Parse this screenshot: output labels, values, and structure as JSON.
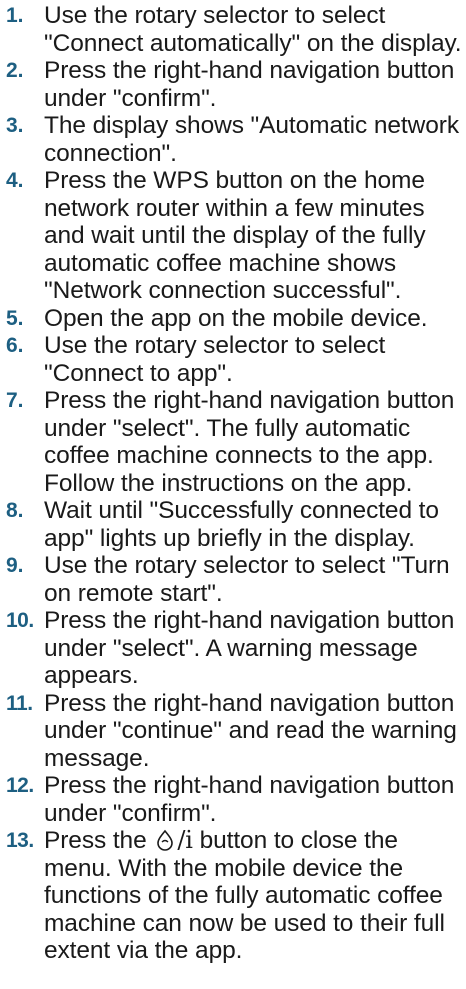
{
  "steps": [
    {
      "number": "1.",
      "text": "Use the rotary selector to select \"Connect automatically\" on the display."
    },
    {
      "number": "2.",
      "text": "Press the right-hand navigation button under \"confirm\"."
    },
    {
      "number": "3.",
      "text": "The display shows \"Automatic network connection\"."
    },
    {
      "number": "4.",
      "text": "Press the WPS button on the home network router within a few minutes and wait until the display of the fully automatic coffee machine shows \"Network connection successful\"."
    },
    {
      "number": "5.",
      "text": "Open the app on the mobile device."
    },
    {
      "number": "6.",
      "text": "Use the rotary selector to select \"Connect to app\"."
    },
    {
      "number": "7.",
      "text": "Press the right-hand navigation button under \"select\". The fully automatic coffee machine connects to the app. Follow the instructions on the app."
    },
    {
      "number": "8.",
      "text": "Wait until \"Successfully connected to app\" lights up briefly in the display."
    },
    {
      "number": "9.",
      "text": "Use the rotary selector to select \"Turn on remote start\"."
    },
    {
      "number": "10.",
      "text": "Press the right-hand navigation button under \"select\". A warning message appears."
    },
    {
      "number": "11.",
      "text": "Press the right-hand navigation button under \"continue\" and read the warning message."
    },
    {
      "number": "12.",
      "text": "Press the right-hand navigation button under \"confirm\"."
    }
  ],
  "step13": {
    "number": "13.",
    "before": "Press the",
    "symbol_suffix": "/i",
    "after": "button to close the menu. With the mobile device the functions of the fully automatic coffee machine can now be used to their full extent via the app."
  },
  "colors": {
    "step_number": "#1d5f82",
    "text": "#1a1a1a"
  },
  "icons": {
    "step13_symbol": "coffee-drop-icon"
  }
}
